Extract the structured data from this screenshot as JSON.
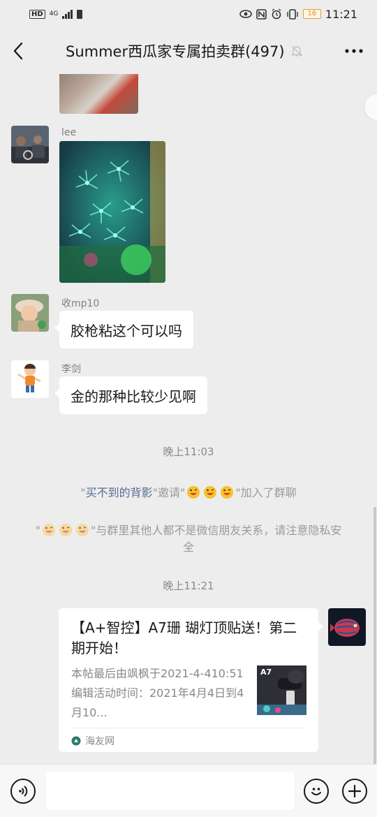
{
  "status_bar": {
    "hd": "HD",
    "network": "4G",
    "battery": "16",
    "time": "11:21"
  },
  "header": {
    "title": "Summer西瓜家专属拍卖群(497)",
    "icons": [
      "back-icon",
      "mute-bell-icon",
      "more-icon"
    ]
  },
  "messages": [
    {
      "sender": "lee",
      "type": "image"
    },
    {
      "sender": "收mp10",
      "type": "text",
      "text": "胶枪粘这个可以吗"
    },
    {
      "sender": "李剑",
      "type": "text",
      "text": "金的那种比较少见啊"
    }
  ],
  "time_1": "晚上11:03",
  "system_invite": {
    "quote_open": "\"",
    "inviter": "买不到的背影",
    "middle": "\"邀请\"",
    "suffix": "\"加入了群聊"
  },
  "system_notice": {
    "prefix": "\"",
    "text": "\"与群里其他人都不是微信朋友关系，请注意隐私安全"
  },
  "time_2": "晚上11:21",
  "link_card": {
    "title": "【A+智控】A7珊 瑚灯顶贴送！第二期开始！",
    "description": "本帖最后由飒枫于2021-4-410:51编辑活动时间：2021年4月4日到4月10...",
    "thumb_label": "A7",
    "source": "海友网"
  },
  "input_bar": {
    "icons": [
      "voice-icon",
      "emoji-icon",
      "add-icon"
    ]
  },
  "colors": {
    "background": "#ededed",
    "link": "#576b95",
    "system_text": "#9a9a9a"
  }
}
